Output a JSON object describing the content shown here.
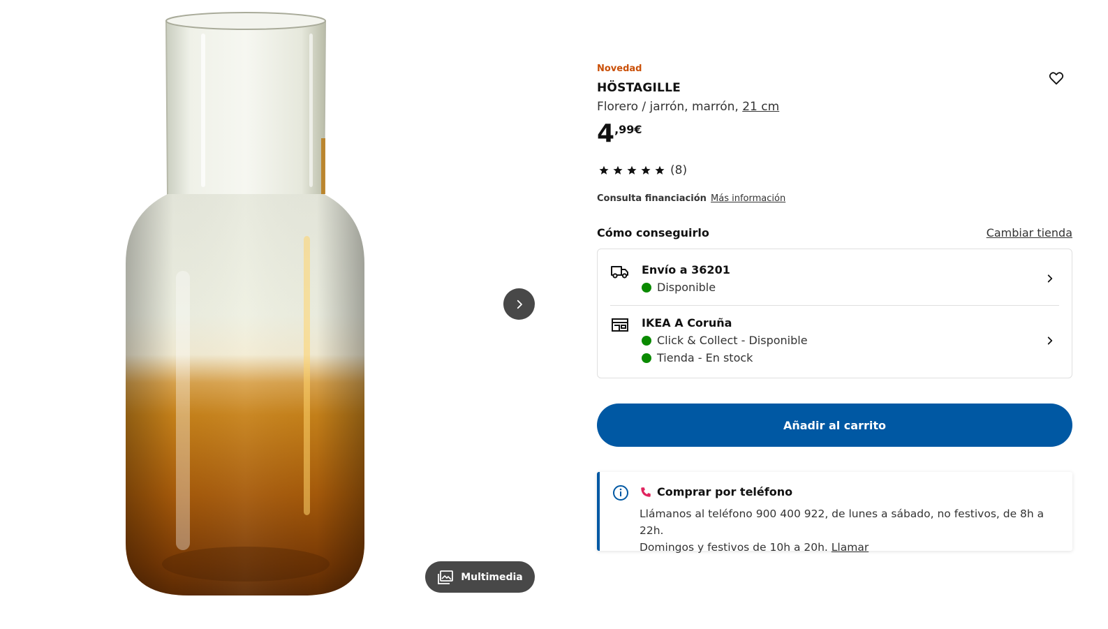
{
  "gallery": {
    "image_alt": "HÖSTAGILLE florero / jarrón, marrón",
    "next_icon": "chevron-right-icon",
    "media_icon": "gallery-icon",
    "media_label": "Multimedia"
  },
  "product": {
    "badge": "Novedad",
    "name": "HÖSTAGILLE",
    "description": "Florero / jarrón, marrón, ",
    "size_link": "21 cm",
    "price_integer": "4",
    "price_decimals": ",99€",
    "rating_count": "(8)",
    "rating_stars": 5,
    "favourite_icon": "heart-icon"
  },
  "finance": {
    "label": "Consulta financiación",
    "link": "Más información"
  },
  "availability": {
    "heading": "Cómo conseguirlo",
    "change_store": "Cambiar tienda",
    "delivery": {
      "icon": "truck-icon",
      "title": "Envío a 36201",
      "status": "Disponible"
    },
    "store": {
      "icon": "store-icon",
      "title": "IKEA A Coruña",
      "click_collect": "Click & Collect - Disponible",
      "in_store": "Tienda - En stock"
    },
    "status_color": "#0a8a00"
  },
  "cart": {
    "label": "Añadir al carrito",
    "color": "#0058a3"
  },
  "phone": {
    "info_icon": "info-icon",
    "phone_icon": "phone-icon",
    "title": "Comprar por teléfono",
    "line1": "Llámanos al teléfono 900 400 922, de lunes a sábado, no festivos, de 8h a 22h.",
    "line2": "Domingos y festivos de 10h a 20h. ",
    "call_link": "Llamar"
  },
  "colors": {
    "badge": "#ca5008",
    "accent": "#0058a3",
    "dark_control": "#484848"
  }
}
